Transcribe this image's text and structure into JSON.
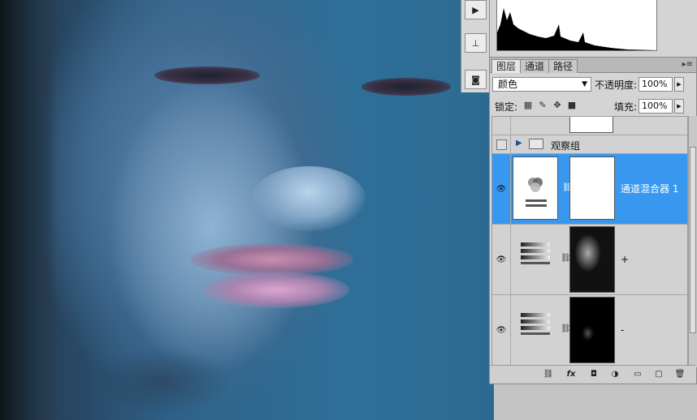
{
  "tools": {
    "play": "play-icon",
    "stamp": "clone-source-icon",
    "camera": "snapshot-icon"
  },
  "panel": {
    "tabs": [
      {
        "label": "图层",
        "active": true
      },
      {
        "label": "通道",
        "active": false
      },
      {
        "label": "路径",
        "active": false
      }
    ],
    "blend_mode": "颜色",
    "opacity_label": "不透明度:",
    "opacity_value": "100%",
    "lock_label": "锁定:",
    "fill_label": "填充:",
    "fill_value": "100%"
  },
  "layers": [
    {
      "name": "",
      "type": "partial"
    },
    {
      "name": "观察组",
      "type": "group"
    },
    {
      "name": "通道混合器 1",
      "type": "adjustment",
      "selected": true
    },
    {
      "name": "+",
      "type": "adjustment-mask"
    },
    {
      "name": "-",
      "type": "adjustment-mask"
    }
  ],
  "colors": {
    "selected_row": "#3898f0",
    "panel_bg": "#d4d4d4",
    "photo_tone": "#2f6f98"
  }
}
